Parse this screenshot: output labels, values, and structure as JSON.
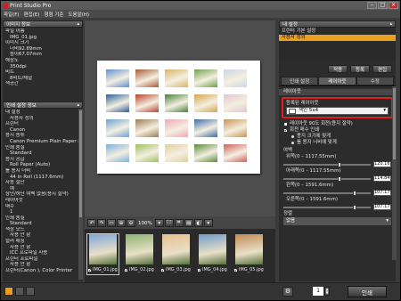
{
  "app": {
    "title": "Print Studio Pro"
  },
  "menu": [
    "파일(F)",
    "편집(E)",
    "형형 기준",
    "도움말(H)"
  ],
  "left": {
    "image_info_title": "이미지 정보",
    "image_info": [
      {
        "text": "파일 이름",
        "indent": 0
      },
      {
        "text": "IMG_01.jpg",
        "indent": 1
      },
      {
        "text": "이미지 크기",
        "indent": 0
      },
      {
        "text": "너비92.89mm",
        "indent": 1
      },
      {
        "text": "높이67.07mm",
        "indent": 1
      },
      {
        "text": "해상도",
        "indent": 0
      },
      {
        "text": "350dpi",
        "indent": 1
      },
      {
        "text": "비트",
        "indent": 0
      },
      {
        "text": "8비트/채널",
        "indent": 1
      },
      {
        "text": "색공간",
        "indent": 0
      }
    ],
    "print_info_title": "인쇄 설정 정보",
    "print_info": [
      {
        "text": "내 설정",
        "indent": 0
      },
      {
        "text": "사용자 정의",
        "indent": 1
      },
      {
        "text": "프린터",
        "indent": 0
      },
      {
        "text": "Canon",
        "indent": 1
      },
      {
        "text": "용지 종류",
        "indent": 0
      },
      {
        "text": "Canon Premium Plain Paper 80",
        "indent": 1
      },
      {
        "text": "인쇄 품질",
        "indent": 0
      },
      {
        "text": "Standard",
        "indent": 1
      },
      {
        "text": "용지 공급",
        "indent": 0
      },
      {
        "text": "Roll Paper (Auto)",
        "indent": 1
      },
      {
        "text": "롤 용지 너비",
        "indent": 0
      },
      {
        "text": "44 in Roll (1117.6mm)",
        "indent": 1
      },
      {
        "text": "자동 절단",
        "indent": 0
      },
      {
        "text": "예",
        "indent": 1
      },
      {
        "text": "상단/하단 여백 없음(용지 절약)",
        "indent": 0
      },
      {
        "text": "레이아웃",
        "indent": 0
      },
      {
        "text": "매수",
        "indent": 0
      },
      {
        "text": "1",
        "indent": 1
      },
      {
        "text": "인쇄 품질",
        "indent": 0
      },
      {
        "text": "Standard",
        "indent": 1
      },
      {
        "text": "색상 모드",
        "indent": 0
      },
      {
        "text": "사용 안 함",
        "indent": 1
      },
      {
        "text": "컬러 매칭",
        "indent": 0
      },
      {
        "text": "사용 안 함",
        "indent": 1
      },
      {
        "text": "ICC 프로파일 사용",
        "indent": 1
      },
      {
        "text": "프린터 프로파일",
        "indent": 0
      },
      {
        "text": "사용 안 함",
        "indent": 1
      },
      {
        "text": "프린터(Canon ), Color Printer",
        "indent": 0
      }
    ]
  },
  "center": {
    "zoom": "100%",
    "filmstrip": [
      {
        "name": "IMG_01.jpg",
        "checked": true,
        "color": "#7fa6d8"
      },
      {
        "name": "IMG_02.jpg",
        "checked": true,
        "color": "#8cb270"
      },
      {
        "name": "IMG_03.jpg",
        "checked": true,
        "color": "#e8c090"
      },
      {
        "name": "IMG_04.jpg",
        "checked": true,
        "color": "#6f9cc8"
      },
      {
        "name": "IMG_05.jpg",
        "checked": true,
        "color": "#c08a55"
      }
    ]
  },
  "right": {
    "my_settings_title": "내 설정",
    "nav_items": [
      {
        "label": "프린터 기본 설정",
        "selected": false
      },
      {
        "label": "사용자 정의",
        "selected": true
      }
    ],
    "apply_label": "적용",
    "register_label": "등록",
    "edit_label": "편집",
    "tabs": [
      "인쇄 설정",
      "레이아웃",
      "수정"
    ],
    "active_tab": 1,
    "layout_section": "레이아웃",
    "registered_layout_label": "등록된 레이아웃",
    "layout_select_value": "색인 5x4",
    "layout_select_arrow": "▾",
    "opt_rotate": "레이아웃 90도 회전(용지 절약)",
    "opt_fit": "회전 매수 인쇄",
    "radio_size": "용지 크기에 맞게",
    "radio_width": "롤 용지 너비에 맞게",
    "margin_label": "여백",
    "margins": [
      {
        "label": "위쪽(0 – 1117.55mm)",
        "value": "120.16",
        "fraction": 0.62
      },
      {
        "label": "아래쪽(0 – 1117.55mm)",
        "value": "114.84",
        "fraction": 0.62
      },
      {
        "label": "왼쪽(0 – 1591.6mm)",
        "value": "107.17",
        "fraction": 0.8
      },
      {
        "label": "오른쪽(0 – 1591.6mm)",
        "value": "107.17",
        "fraction": 0.8
      }
    ],
    "align_label": "정렬",
    "align_value": "없음"
  },
  "bottom": {
    "copies": "1",
    "print_label": "인쇄"
  },
  "layout_thumbnail_colors": [
    "#5f8fd0",
    "#a85a38",
    "#d9b36a",
    "#6fa14a",
    "#ccd7e8",
    "#2c5e99",
    "#b8422e",
    "#4a7f3c",
    "#d8a44c",
    "#e0c6d0",
    "#6aa3d9",
    "#9c7c54",
    "#f0a8b8",
    "#3d6ea8",
    "#c89454",
    "#7ab0da",
    "#a0c060",
    "#e0d0a0",
    "#5a8a3a",
    "#d0605a"
  ]
}
